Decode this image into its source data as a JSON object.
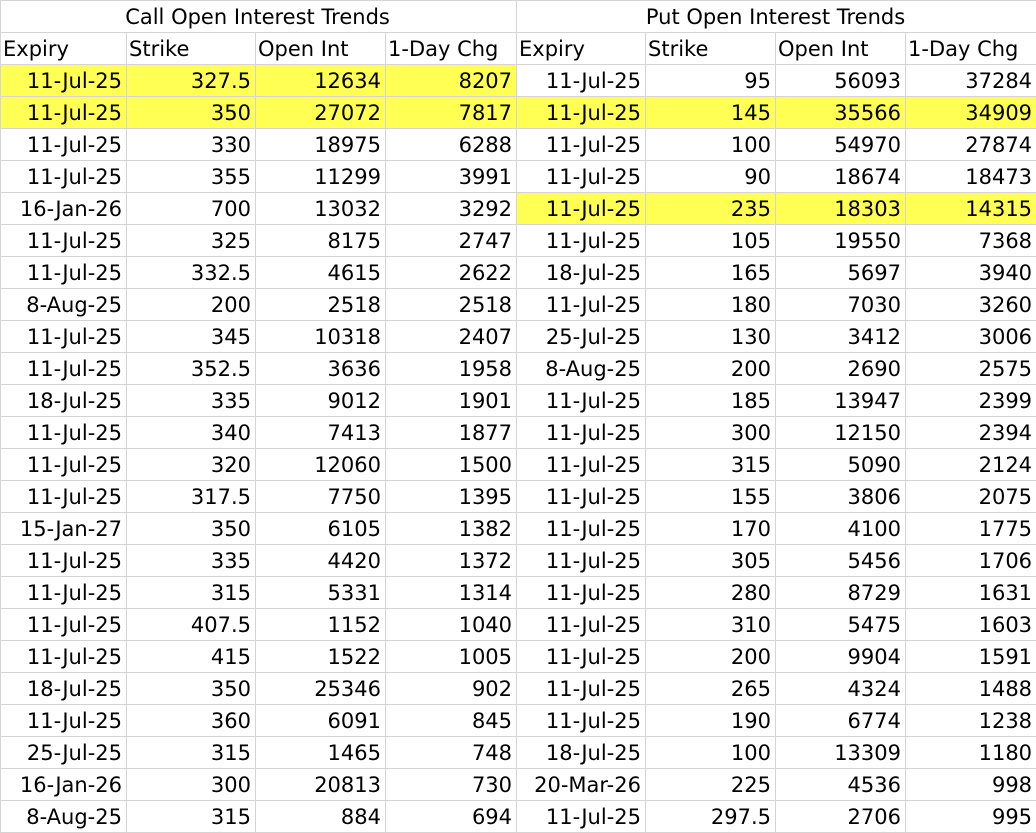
{
  "call": {
    "title": "Call Open Interest Trends",
    "columns": [
      "Expiry",
      "Strike",
      "Open Int",
      "1-Day Chg"
    ],
    "rows": [
      {
        "cells": [
          "11-Jul-25",
          "327.5",
          "12634",
          "8207"
        ],
        "highlight": true
      },
      {
        "cells": [
          "11-Jul-25",
          "350",
          "27072",
          "7817"
        ],
        "highlight": true
      },
      {
        "cells": [
          "11-Jul-25",
          "330",
          "18975",
          "6288"
        ],
        "highlight": false
      },
      {
        "cells": [
          "11-Jul-25",
          "355",
          "11299",
          "3991"
        ],
        "highlight": false
      },
      {
        "cells": [
          "16-Jan-26",
          "700",
          "13032",
          "3292"
        ],
        "highlight": false
      },
      {
        "cells": [
          "11-Jul-25",
          "325",
          "8175",
          "2747"
        ],
        "highlight": false
      },
      {
        "cells": [
          "11-Jul-25",
          "332.5",
          "4615",
          "2622"
        ],
        "highlight": false
      },
      {
        "cells": [
          "8-Aug-25",
          "200",
          "2518",
          "2518"
        ],
        "highlight": false
      },
      {
        "cells": [
          "11-Jul-25",
          "345",
          "10318",
          "2407"
        ],
        "highlight": false
      },
      {
        "cells": [
          "11-Jul-25",
          "352.5",
          "3636",
          "1958"
        ],
        "highlight": false
      },
      {
        "cells": [
          "18-Jul-25",
          "335",
          "9012",
          "1901"
        ],
        "highlight": false
      },
      {
        "cells": [
          "11-Jul-25",
          "340",
          "7413",
          "1877"
        ],
        "highlight": false
      },
      {
        "cells": [
          "11-Jul-25",
          "320",
          "12060",
          "1500"
        ],
        "highlight": false
      },
      {
        "cells": [
          "11-Jul-25",
          "317.5",
          "7750",
          "1395"
        ],
        "highlight": false
      },
      {
        "cells": [
          "15-Jan-27",
          "350",
          "6105",
          "1382"
        ],
        "highlight": false
      },
      {
        "cells": [
          "11-Jul-25",
          "335",
          "4420",
          "1372"
        ],
        "highlight": false
      },
      {
        "cells": [
          "11-Jul-25",
          "315",
          "5331",
          "1314"
        ],
        "highlight": false
      },
      {
        "cells": [
          "11-Jul-25",
          "407.5",
          "1152",
          "1040"
        ],
        "highlight": false
      },
      {
        "cells": [
          "11-Jul-25",
          "415",
          "1522",
          "1005"
        ],
        "highlight": false
      },
      {
        "cells": [
          "18-Jul-25",
          "350",
          "25346",
          "902"
        ],
        "highlight": false
      },
      {
        "cells": [
          "11-Jul-25",
          "360",
          "6091",
          "845"
        ],
        "highlight": false
      },
      {
        "cells": [
          "25-Jul-25",
          "315",
          "1465",
          "748"
        ],
        "highlight": false
      },
      {
        "cells": [
          "16-Jan-26",
          "300",
          "20813",
          "730"
        ],
        "highlight": false
      },
      {
        "cells": [
          "8-Aug-25",
          "315",
          "884",
          "694"
        ],
        "highlight": false
      }
    ]
  },
  "put": {
    "title": "Put Open Interest Trends",
    "columns": [
      "Expiry",
      "Strike",
      "Open Int",
      "1-Day Chg"
    ],
    "rows": [
      {
        "cells": [
          "11-Jul-25",
          "95",
          "56093",
          "37284"
        ],
        "highlight": false
      },
      {
        "cells": [
          "11-Jul-25",
          "145",
          "35566",
          "34909"
        ],
        "highlight": true
      },
      {
        "cells": [
          "11-Jul-25",
          "100",
          "54970",
          "27874"
        ],
        "highlight": false
      },
      {
        "cells": [
          "11-Jul-25",
          "90",
          "18674",
          "18473"
        ],
        "highlight": false
      },
      {
        "cells": [
          "11-Jul-25",
          "235",
          "18303",
          "14315"
        ],
        "highlight": true
      },
      {
        "cells": [
          "11-Jul-25",
          "105",
          "19550",
          "7368"
        ],
        "highlight": false
      },
      {
        "cells": [
          "18-Jul-25",
          "165",
          "5697",
          "3940"
        ],
        "highlight": false
      },
      {
        "cells": [
          "11-Jul-25",
          "180",
          "7030",
          "3260"
        ],
        "highlight": false
      },
      {
        "cells": [
          "25-Jul-25",
          "130",
          "3412",
          "3006"
        ],
        "highlight": false
      },
      {
        "cells": [
          "8-Aug-25",
          "200",
          "2690",
          "2575"
        ],
        "highlight": false
      },
      {
        "cells": [
          "11-Jul-25",
          "185",
          "13947",
          "2399"
        ],
        "highlight": false
      },
      {
        "cells": [
          "11-Jul-25",
          "300",
          "12150",
          "2394"
        ],
        "highlight": false
      },
      {
        "cells": [
          "11-Jul-25",
          "315",
          "5090",
          "2124"
        ],
        "highlight": false
      },
      {
        "cells": [
          "11-Jul-25",
          "155",
          "3806",
          "2075"
        ],
        "highlight": false
      },
      {
        "cells": [
          "11-Jul-25",
          "170",
          "4100",
          "1775"
        ],
        "highlight": false
      },
      {
        "cells": [
          "11-Jul-25",
          "305",
          "5456",
          "1706"
        ],
        "highlight": false
      },
      {
        "cells": [
          "11-Jul-25",
          "280",
          "8729",
          "1631"
        ],
        "highlight": false
      },
      {
        "cells": [
          "11-Jul-25",
          "310",
          "5475",
          "1603"
        ],
        "highlight": false
      },
      {
        "cells": [
          "11-Jul-25",
          "200",
          "9904",
          "1591"
        ],
        "highlight": false
      },
      {
        "cells": [
          "11-Jul-25",
          "265",
          "4324",
          "1488"
        ],
        "highlight": false
      },
      {
        "cells": [
          "11-Jul-25",
          "190",
          "6774",
          "1238"
        ],
        "highlight": false
      },
      {
        "cells": [
          "18-Jul-25",
          "100",
          "13309",
          "1180"
        ],
        "highlight": false
      },
      {
        "cells": [
          "20-Mar-26",
          "225",
          "4536",
          "998"
        ],
        "highlight": false
      },
      {
        "cells": [
          "11-Jul-25",
          "297.5",
          "2706",
          "995"
        ],
        "highlight": false
      }
    ]
  },
  "highlight_color": "#ffff54"
}
